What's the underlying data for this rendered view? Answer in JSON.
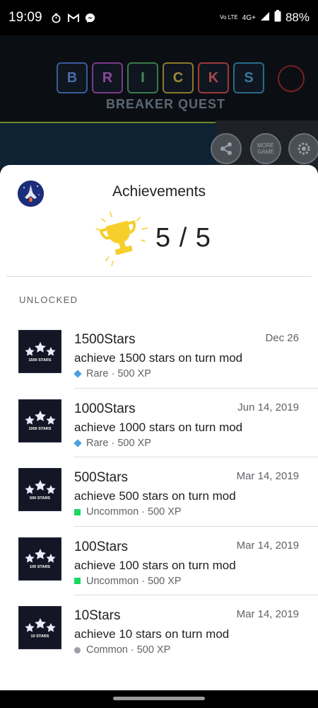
{
  "status_bar": {
    "time": "19:09",
    "network": "4G+",
    "volte": "Vo LTE",
    "battery": "88%",
    "icons": [
      "timer-icon",
      "gmail-icon",
      "messenger-icon",
      "signal-icon",
      "battery-icon"
    ]
  },
  "background": {
    "bricks": [
      "B",
      "R",
      "I",
      "C",
      "K",
      "S"
    ],
    "subtitle": "BREAKER QUEST",
    "more_games": "MORE GAME"
  },
  "sheet": {
    "title": "Achievements",
    "score": "5 / 5",
    "section": "UNLOCKED",
    "items": [
      {
        "name": "1500Stars",
        "date": "Dec 26",
        "desc": "achieve 1500 stars on turn mod",
        "rarity": "Rare · 500 XP",
        "badge": "1500 STARS",
        "rarity_type": "rare"
      },
      {
        "name": "1000Stars",
        "date": "Jun 14, 2019",
        "desc": "achieve 1000 stars on turn mod",
        "rarity": "Rare · 500 XP",
        "badge": "1000 STARS",
        "rarity_type": "rare"
      },
      {
        "name": "500Stars",
        "date": "Mar 14, 2019",
        "desc": "achieve 500 stars on turn mod",
        "rarity": "Uncommon · 500 XP",
        "badge": "500 STARS",
        "rarity_type": "uncommon"
      },
      {
        "name": "100Stars",
        "date": "Mar 14, 2019",
        "desc": "achieve 100 stars on turn mod",
        "rarity": "Uncommon · 500 XP",
        "badge": "100 STARS",
        "rarity_type": "uncommon"
      },
      {
        "name": "10Stars",
        "date": "Mar 14, 2019",
        "desc": "achieve 10 stars on turn mod",
        "rarity": "Common · 500 XP",
        "badge": "10 STARS",
        "rarity_type": "common"
      }
    ]
  },
  "colors": {
    "rare": "#4a9fe0",
    "uncommon": "#1ed760",
    "common": "#9aa0a6",
    "trophy": "#f6cf2b"
  }
}
